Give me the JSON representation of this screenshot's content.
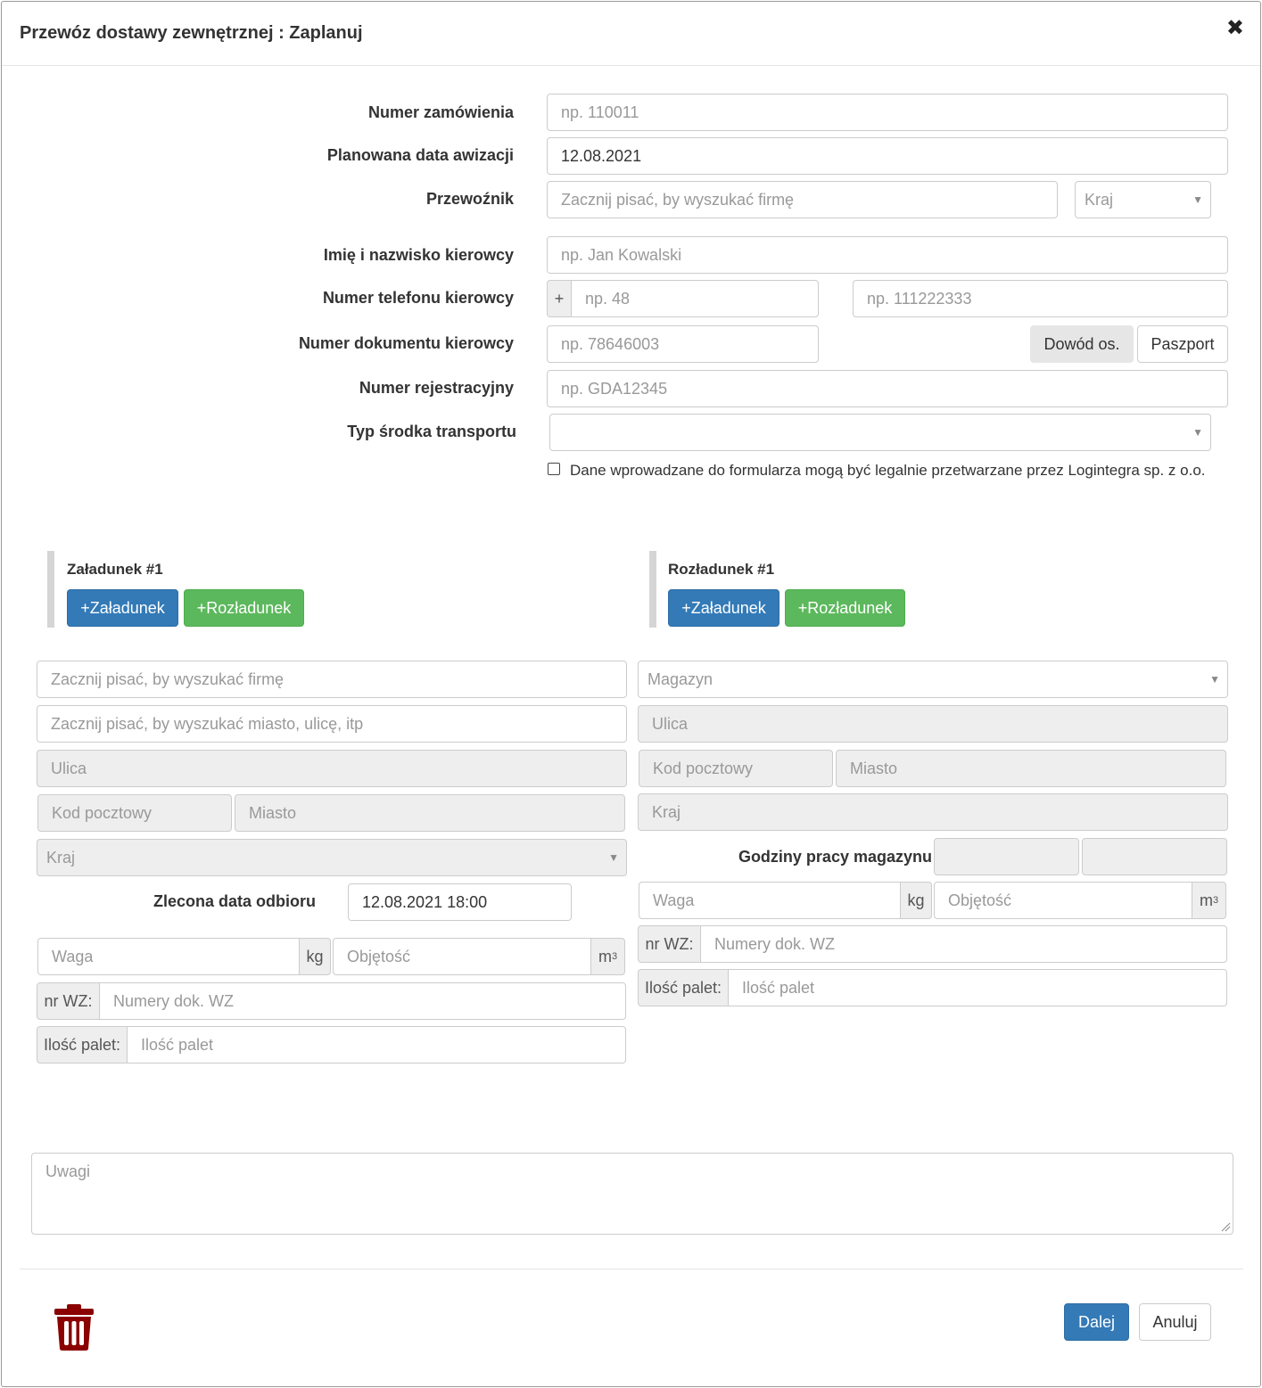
{
  "header": {
    "title": "Przewóz dostawy zewnętrznej : Zaplanuj",
    "close_glyph": "✖"
  },
  "form": {
    "order_number": {
      "label": "Numer zamówienia",
      "placeholder": "np. 110011"
    },
    "planned_date": {
      "label": "Planowana data awizacji",
      "value": "12.08.2021"
    },
    "carrier": {
      "label": "Przewoźnik",
      "placeholder": "Zacznij pisać, by wyszukać firmę",
      "country_placeholder": "Kraj"
    },
    "driver_name": {
      "label": "Imię i nazwisko kierowcy",
      "placeholder": "np. Jan Kowalski"
    },
    "driver_phone": {
      "label": "Numer telefonu kierowcy",
      "prefix": "+",
      "code_placeholder": "np. 48",
      "number_placeholder": "np. 111222333"
    },
    "driver_document": {
      "label": "Numer dokumentu kierowcy",
      "placeholder": "np. 78646003",
      "id_button": "Dowód os.",
      "passport_button": "Paszport"
    },
    "registration": {
      "label": "Numer rejestracyjny",
      "placeholder": "np. GDA12345"
    },
    "transport_type": {
      "label": "Typ środka transportu",
      "value": ""
    },
    "consent": "Dane wprowadzane do formularza mogą być legalnie przetwarzane przez Logintegra sp. z o.o."
  },
  "loading": {
    "title": "Załadunek #1",
    "add_loading": "+Załadunek",
    "add_unloading": "+Rozładunek",
    "company_placeholder": "Zacznij pisać, by wyszukać firmę",
    "address_search_placeholder": "Zacznij pisać, by wyszukać miasto, ulicę, itp",
    "street": "Ulica",
    "postal_code": "Kod pocztowy",
    "city": "Miasto",
    "country": "Kraj",
    "pickup_date_label": "Zlecona data odbioru",
    "pickup_date_value": "12.08.2021 18:00",
    "weight_placeholder": "Waga",
    "weight_unit": "kg",
    "volume_placeholder": "Objętość",
    "volume_unit": "m",
    "volume_unit_exp": "3",
    "wz_label": "nr WZ:",
    "wz_placeholder": "Numery dok. WZ",
    "pallets_label": "Ilość palet:",
    "pallets_placeholder": "Ilość palet"
  },
  "unloading": {
    "title": "Rozładunek #1",
    "add_loading": "+Załadunek",
    "add_unloading": "+Rozładunek",
    "warehouse_placeholder": "Magazyn",
    "street": "Ulica",
    "postal_code": "Kod pocztowy",
    "city": "Miasto",
    "country": "Kraj",
    "hours_label": "Godziny pracy magazynu",
    "weight_placeholder": "Waga",
    "weight_unit": "kg",
    "volume_placeholder": "Objętość",
    "volume_unit": "m",
    "volume_unit_exp": "3",
    "wz_label": "nr WZ:",
    "wz_placeholder": "Numery dok. WZ",
    "pallets_label": "Ilość palet:",
    "pallets_placeholder": "Ilość palet"
  },
  "notes": {
    "placeholder": "Uwagi"
  },
  "footer": {
    "next": "Dalej",
    "cancel": "Anuluj"
  },
  "colors": {
    "primary": "#337ab7",
    "success": "#5cb85c",
    "danger": "#8b0000"
  }
}
